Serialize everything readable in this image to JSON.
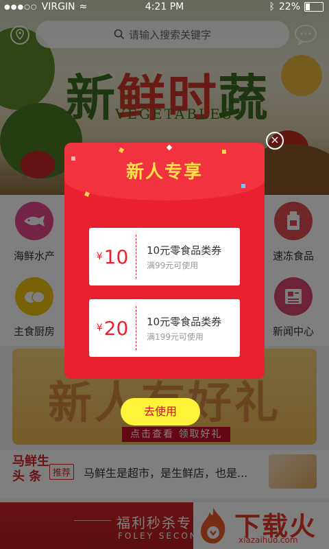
{
  "status_bar": {
    "carrier": "VIRGIN",
    "time": "4:21 PM",
    "battery": "22%"
  },
  "header": {
    "search_placeholder": "请输入搜索关键字"
  },
  "banner": {
    "title_part1": "新",
    "title_part2": "鲜时",
    "title_part3": "蔬",
    "subtitle": "VEGETABLES"
  },
  "categories": [
    {
      "label": "海鲜水产",
      "icon": "fish-icon",
      "color": "#e6498c"
    },
    {
      "label": "速冻食品",
      "icon": "package-icon",
      "color": "#e04a50"
    },
    {
      "label": "主食厨房",
      "icon": "bread-icon",
      "color": "#f0c20e"
    },
    {
      "label": "新闻中心",
      "icon": "news-icon",
      "color": "#d8456f"
    }
  ],
  "promo": {
    "title": "新人有好礼",
    "cta": "点击查看 领取好礼"
  },
  "news": {
    "brand_line1": "马鲜生",
    "brand_line2": "头 条",
    "tag": "推荐",
    "text": "马鲜生是超市，是生鲜店，也是..."
  },
  "flash_sale": {
    "title": "福利秒杀专",
    "subtitle": "FOLEY SECON"
  },
  "watermark": {
    "brand": "下载火",
    "url": "xiazaihuo.com"
  },
  "modal": {
    "title": "新人专享",
    "coupons": [
      {
        "currency": "¥",
        "amount": "10",
        "title": "10元零食品类券",
        "condition": "满99元可使用"
      },
      {
        "currency": "¥",
        "amount": "20",
        "title": "10元零食品类券",
        "condition": "满199元可使用"
      }
    ],
    "use_button": "去使用",
    "close": "×"
  },
  "colors": {
    "modal_red": "#e8202f",
    "title_yellow": "#ffe24a",
    "button_yellow": "#fff33a"
  }
}
